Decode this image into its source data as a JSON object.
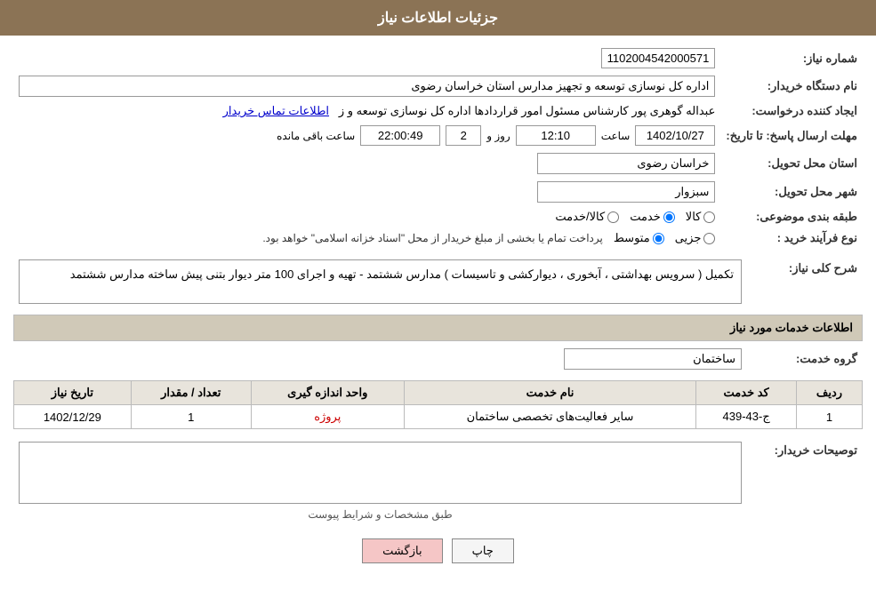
{
  "header": {
    "title": "جزئیات اطلاعات نیاز"
  },
  "fields": {
    "shomara_label": "شماره نیاز:",
    "shomara_value": "1102004542000571",
    "name_darkhast_label": "نام دستگاه خریدار:",
    "name_darkhast_value": "اداره کل نوسازی  توسعه و تجهیز مدارس استان خراسان رضوی",
    "creator_label": "ایجاد کننده درخواست:",
    "creator_value": "عبداله گوهری پور کارشناس مسئول امور قراردادها  اداره کل نوسازی  توسعه و ز",
    "creator_link": "اطلاعات تماس خریدار",
    "mohlat_label": "مهلت ارسال پاسخ: تا تاریخ:",
    "date_value": "1402/10/27",
    "time_value": "12:10",
    "days_label": "روز و",
    "days_value": "2",
    "remaining_label": "ساعت باقی مانده",
    "remaining_value": "22:00:49",
    "ostan_label": "استان محل تحویل:",
    "ostan_value": "خراسان رضوی",
    "shahr_label": "شهر محل تحویل:",
    "shahr_value": "سبزوار",
    "tabaqebandi_label": "طبقه بندی موضوعی:",
    "tabaqe_options": [
      "کالا",
      "خدمت",
      "کالا/خدمت"
    ],
    "tabaqe_selected": "خدمت",
    "farayand_label": "نوع فرآیند خرید :",
    "farayand_options": [
      "جزیی",
      "متوسط",
      ""
    ],
    "farayand_selected": "متوسط",
    "farayand_note": "پرداخت تمام یا بخشی از مبلغ خریدار از محل \"اسناد خزانه اسلامی\" خواهد بود.",
    "sharh_label": "شرح کلی نیاز:",
    "sharh_value": "تکمیل ( سرویس بهداشتی ، آبخوری ، دیوارکشی و تاسیسات ) مدارس ششتمد - تهیه و اجرای 100 متر دیوار بتنی پیش ساخته مدارس ششتمد",
    "khadamat_title": "اطلاعات خدمات مورد نیاز",
    "group_label": "گروه خدمت:",
    "group_value": "ساختمان",
    "table": {
      "headers": [
        "ردیف",
        "کد خدمت",
        "نام خدمت",
        "واحد اندازه گیری",
        "تعداد / مقدار",
        "تاریخ نیاز"
      ],
      "rows": [
        {
          "radif": "1",
          "code": "ج-43-439",
          "name": "سایر فعالیت‌های تخصصی ساختمان",
          "unit": "پروژه",
          "count": "1",
          "date": "1402/12/29"
        }
      ]
    },
    "tosif_label": "توصیحات خریدار:",
    "tosif_value": "طبق مشخصات و شرایط پیوست"
  },
  "buttons": {
    "print": "چاپ",
    "back": "بازگشت"
  }
}
